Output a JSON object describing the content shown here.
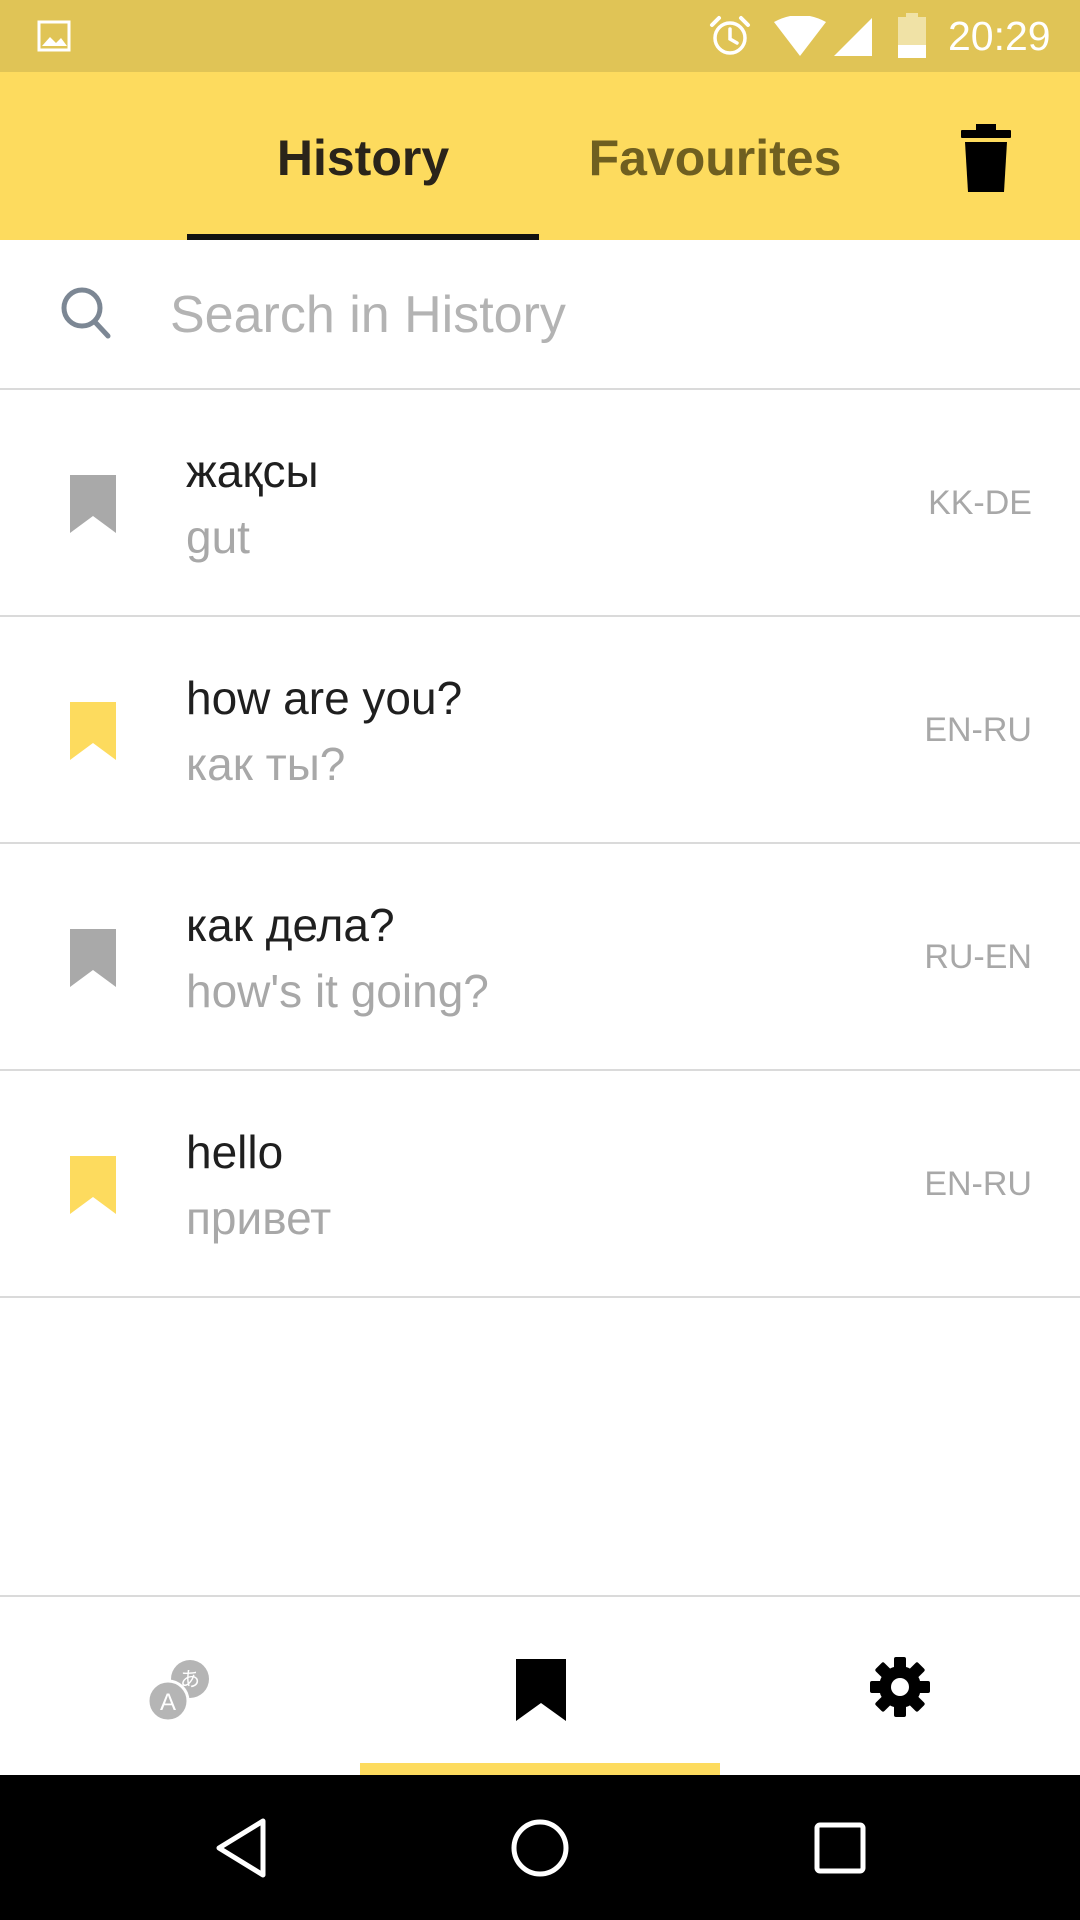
{
  "status_bar": {
    "time": "20:29",
    "icons": [
      "image-notification-icon",
      "alarm-icon",
      "wifi-icon",
      "cell-signal-icon",
      "battery-icon"
    ]
  },
  "app_bar": {
    "tabs": [
      {
        "label": "History",
        "selected": true
      },
      {
        "label": "Favourites",
        "selected": false
      }
    ],
    "action_icon": "trash-icon"
  },
  "search": {
    "placeholder": "Search in History",
    "value": "",
    "icon": "search-icon"
  },
  "history": {
    "items": [
      {
        "source": "жақсы",
        "translation": "gut",
        "lang": "KK-DE",
        "favourite": false
      },
      {
        "source": "how are you?",
        "translation": "как ты?",
        "lang": "EN-RU",
        "favourite": true
      },
      {
        "source": "как дела?",
        "translation": "how's it going?",
        "lang": "RU-EN",
        "favourite": false
      },
      {
        "source": "hello",
        "translation": "привет",
        "lang": "EN-RU",
        "favourite": true
      }
    ]
  },
  "bottom_nav": {
    "items": [
      {
        "icon": "translate-icon",
        "selected": false
      },
      {
        "icon": "bookmark-icon",
        "selected": true
      },
      {
        "icon": "settings-gear-icon",
        "selected": false
      }
    ]
  },
  "system_nav": {
    "buttons": [
      "back-icon",
      "home-icon",
      "recents-icon"
    ]
  },
  "colors": {
    "status_bar": "#e0c456",
    "app_bar": "#fddb5e",
    "favourite_on": "#fddb5e",
    "favourite_off": "#a9a9a9",
    "secondary_text": "#a8a8a8",
    "divider": "#dadada"
  }
}
